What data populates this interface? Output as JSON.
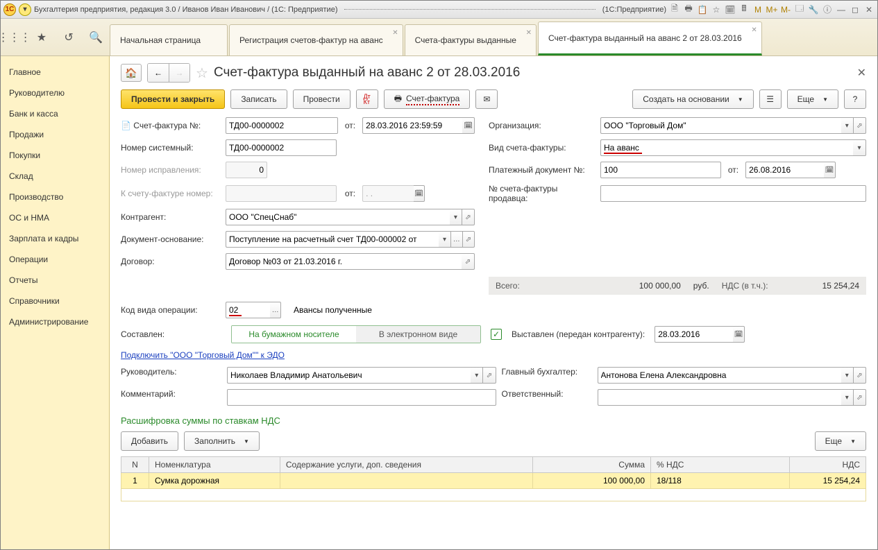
{
  "window": {
    "title_left": "Бухгалтерия предприятия, редакция 3.0 / Иванов Иван Иванович / (1С: Предприятие)",
    "title_right": "(1С:Предприятие)"
  },
  "tabs": [
    {
      "label": "Начальная страница",
      "active": false
    },
    {
      "label": "Регистрация счетов-фактур на аванс",
      "active": false
    },
    {
      "label": "Счета-фактуры выданные",
      "active": false
    },
    {
      "label": "Счет-фактура выданный на аванс 2 от 28.03.2016",
      "active": true
    }
  ],
  "sidebar": {
    "items": [
      "Главное",
      "Руководителю",
      "Банк и касса",
      "Продажи",
      "Покупки",
      "Склад",
      "Производство",
      "ОС и НМА",
      "Зарплата и кадры",
      "Операции",
      "Отчеты",
      "Справочники",
      "Администрирование"
    ]
  },
  "page": {
    "title": "Счет-фактура выданный на аванс 2 от 28.03.2016"
  },
  "toolbar": {
    "post_close": "Провести и закрыть",
    "write": "Записать",
    "post": "Провести",
    "print_invoice": "Счет-фактура",
    "create_based": "Создать на основании",
    "more": "Еще",
    "help": "?"
  },
  "form": {
    "invoice_no_label": "Счет-фактура №:",
    "invoice_no": "ТД00-0000002",
    "from_label": "от:",
    "invoice_date": "28.03.2016 23:59:59",
    "org_label": "Организация:",
    "org": "ООО \"Торговый Дом\"",
    "sys_no_label": "Номер системный:",
    "sys_no": "ТД00-0000002",
    "invoice_type_label": "Вид счета-фактуры:",
    "invoice_type": "На аванс",
    "corr_no_label": "Номер исправления:",
    "corr_no": "0",
    "pay_doc_label": "Платежный документ №:",
    "pay_doc": "100",
    "pay_doc_from_label": "от:",
    "pay_doc_date": "26.08.2016",
    "to_invoice_label": "К счету-фактуре номер:",
    "to_invoice_from": "от:",
    "to_invoice_date": ". .",
    "seller_invoice_label": "№ счета-фактуры продавца:",
    "counterparty_label": "Контрагент:",
    "counterparty": "ООО \"СпецСнаб\"",
    "basis_label": "Документ-основание:",
    "basis": "Поступление на расчетный счет ТД00-000002 от",
    "contract_label": "Договор:",
    "contract": "Договор №03 от 21.03.2016 г.",
    "op_code_label": "Код вида операции:",
    "op_code": "02",
    "op_code_desc": "Авансы полученные",
    "composed_label": "Составлен:",
    "paper": "На бумажном носителе",
    "electronic": "В электронном виде",
    "issued_label": "Выставлен (передан контрагенту):",
    "issued_date": "28.03.2016",
    "edo_link": "Подключить \"ООО \"Торговый Дом\"\" к ЭДО",
    "manager_label": "Руководитель:",
    "manager": "Николаев Владимир Анатольевич",
    "accountant_label": "Главный бухгалтер:",
    "accountant": "Антонова Елена Александровна",
    "comment_label": "Комментарий:",
    "responsible_label": "Ответственный:"
  },
  "summary": {
    "total_label": "Всего:",
    "total": "100 000,00",
    "currency": "руб.",
    "vat_label": "НДС (в т.ч.):",
    "vat": "15 254,24"
  },
  "grid": {
    "title": "Расшифровка суммы по ставкам НДС",
    "add": "Добавить",
    "fill": "Заполнить",
    "more": "Еще",
    "columns": {
      "n": "N",
      "item": "Номенклатура",
      "desc": "Содержание услуги, доп. сведения",
      "sum": "Сумма",
      "vat_rate": "% НДС",
      "vat": "НДС"
    },
    "rows": [
      {
        "n": "1",
        "item": "Сумка дорожная",
        "desc": "",
        "sum": "100 000,00",
        "vat_rate": "18/118",
        "vat": "15 254,24"
      }
    ]
  }
}
